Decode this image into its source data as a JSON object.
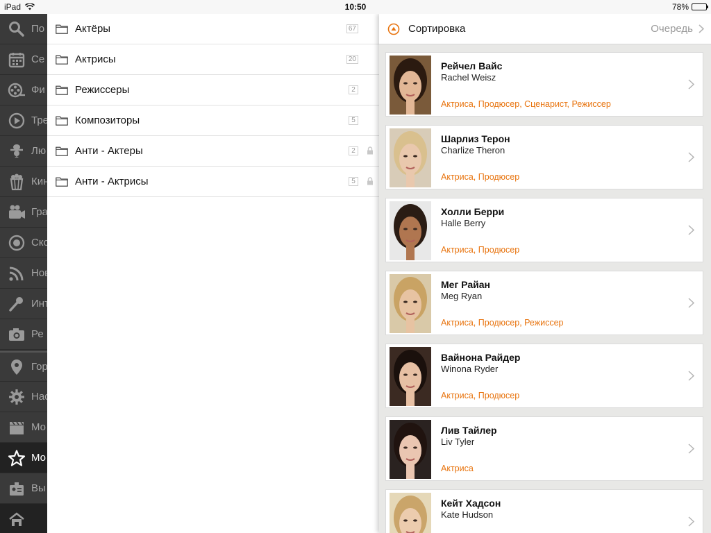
{
  "status_bar": {
    "device": "iPad",
    "time": "10:50",
    "battery": "78%",
    "battery_level": 0.78
  },
  "sidebar": {
    "items": [
      {
        "icon": "search-icon",
        "label": "По"
      },
      {
        "icon": "calendar-icon",
        "label": "Се"
      },
      {
        "icon": "film-reel-icon",
        "label": "Фи"
      },
      {
        "icon": "play-icon",
        "label": "Тре"
      },
      {
        "icon": "people-icon",
        "label": "Лю"
      },
      {
        "icon": "popcorn-icon",
        "label": "Кин"
      },
      {
        "icon": "camera-icon",
        "label": "Гра"
      },
      {
        "icon": "disc-icon",
        "label": "Ско"
      },
      {
        "icon": "rss-icon",
        "label": "Нов"
      },
      {
        "icon": "microphone-icon",
        "label": "Инт"
      },
      {
        "icon": "photo-icon",
        "label": "Ре"
      },
      {
        "icon": "location-pin-icon",
        "label": "Гор"
      },
      {
        "icon": "gear-icon",
        "label": "Нас"
      },
      {
        "icon": "clapperboard-icon",
        "label": "Мо"
      },
      {
        "icon": "star-icon",
        "label": "Мо"
      },
      {
        "icon": "badge-icon",
        "label": "Вы"
      },
      {
        "icon": "home-icon",
        "label": ""
      }
    ],
    "active_index": 14
  },
  "categories": [
    {
      "label": "Актёры",
      "count": "67",
      "locked": false
    },
    {
      "label": "Актрисы",
      "count": "20",
      "locked": false
    },
    {
      "label": "Режиссеры",
      "count": "2",
      "locked": false
    },
    {
      "label": "Композиторы",
      "count": "5",
      "locked": false
    },
    {
      "label": "Анти - Актеры",
      "count": "2",
      "locked": true
    },
    {
      "label": "Анти - Актрисы",
      "count": "5",
      "locked": true
    }
  ],
  "sort_bar": {
    "label": "Сортировка",
    "order_value": "Очередь"
  },
  "people": [
    {
      "name": "Рейчел Вайс",
      "name_en": "Rachel Weisz",
      "roles": "Актриса, Продюсер, Сценарист, Режиссер"
    },
    {
      "name": "Шарлиз Терон",
      "name_en": "Charlize Theron",
      "roles": "Актриса, Продюсер"
    },
    {
      "name": "Холли Берри",
      "name_en": "Halle Berry",
      "roles": "Актриса, Продюсер"
    },
    {
      "name": "Мег Райан",
      "name_en": "Meg Ryan",
      "roles": "Актриса, Продюсер, Режиссер"
    },
    {
      "name": "Вайнона Райдер",
      "name_en": "Winona Ryder",
      "roles": "Актриса, Продюсер"
    },
    {
      "name": "Лив Тайлер",
      "name_en": "Liv Tyler",
      "roles": "Актриса"
    },
    {
      "name": "Кейт Хадсон",
      "name_en": "Kate Hudson",
      "roles": ""
    }
  ],
  "colors": {
    "accent": "#e8740f",
    "sidebar_bg": "#3a3a3a",
    "panel_bg": "#e8e8e6"
  }
}
